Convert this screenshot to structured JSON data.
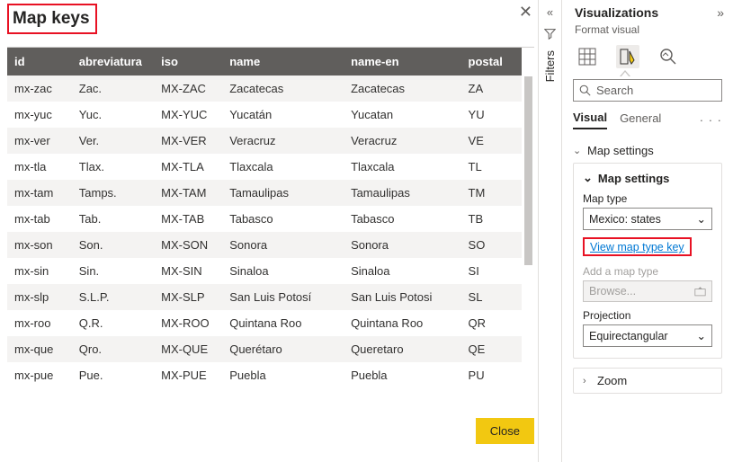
{
  "dialog": {
    "title": "Map keys",
    "close_button": "Close",
    "columns": [
      "id",
      "abreviatura",
      "iso",
      "name",
      "name-en",
      "postal"
    ],
    "rows": [
      {
        "id": "mx-zac",
        "abbr": "Zac.",
        "iso": "MX-ZAC",
        "name": "Zacatecas",
        "name_en": "Zacatecas",
        "postal": "ZA"
      },
      {
        "id": "mx-yuc",
        "abbr": "Yuc.",
        "iso": "MX-YUC",
        "name": "Yucatán",
        "name_en": "Yucatan",
        "postal": "YU"
      },
      {
        "id": "mx-ver",
        "abbr": "Ver.",
        "iso": "MX-VER",
        "name": "Veracruz",
        "name_en": "Veracruz",
        "postal": "VE"
      },
      {
        "id": "mx-tla",
        "abbr": "Tlax.",
        "iso": "MX-TLA",
        "name": "Tlaxcala",
        "name_en": "Tlaxcala",
        "postal": "TL"
      },
      {
        "id": "mx-tam",
        "abbr": "Tamps.",
        "iso": "MX-TAM",
        "name": "Tamaulipas",
        "name_en": "Tamaulipas",
        "postal": "TM"
      },
      {
        "id": "mx-tab",
        "abbr": "Tab.",
        "iso": "MX-TAB",
        "name": "Tabasco",
        "name_en": "Tabasco",
        "postal": "TB"
      },
      {
        "id": "mx-son",
        "abbr": "Son.",
        "iso": "MX-SON",
        "name": "Sonora",
        "name_en": "Sonora",
        "postal": "SO"
      },
      {
        "id": "mx-sin",
        "abbr": "Sin.",
        "iso": "MX-SIN",
        "name": "Sinaloa",
        "name_en": "Sinaloa",
        "postal": "SI"
      },
      {
        "id": "mx-slp",
        "abbr": "S.L.P.",
        "iso": "MX-SLP",
        "name": "San Luis Potosí",
        "name_en": "San Luis Potosi",
        "postal": "SL"
      },
      {
        "id": "mx-roo",
        "abbr": "Q.R.",
        "iso": "MX-ROO",
        "name": "Quintana Roo",
        "name_en": "Quintana Roo",
        "postal": "QR"
      },
      {
        "id": "mx-que",
        "abbr": "Qro.",
        "iso": "MX-QUE",
        "name": "Querétaro",
        "name_en": "Queretaro",
        "postal": "QE"
      },
      {
        "id": "mx-pue",
        "abbr": "Pue.",
        "iso": "MX-PUE",
        "name": "Puebla",
        "name_en": "Puebla",
        "postal": "PU"
      }
    ]
  },
  "filters_pane": {
    "label": "Filters"
  },
  "viz_pane": {
    "title": "Visualizations",
    "subtitle": "Format visual",
    "search_placeholder": "Search",
    "tabs": {
      "visual": "Visual",
      "general": "General"
    },
    "section_map_settings": "Map settings",
    "card_map_settings": {
      "header": "Map settings",
      "map_type_label": "Map type",
      "map_type_value": "Mexico: states",
      "view_key_link": "View map type key",
      "add_map_label": "Add a map type",
      "browse_placeholder": "Browse...",
      "projection_label": "Projection",
      "projection_value": "Equirectangular"
    },
    "section_zoom": "Zoom"
  }
}
